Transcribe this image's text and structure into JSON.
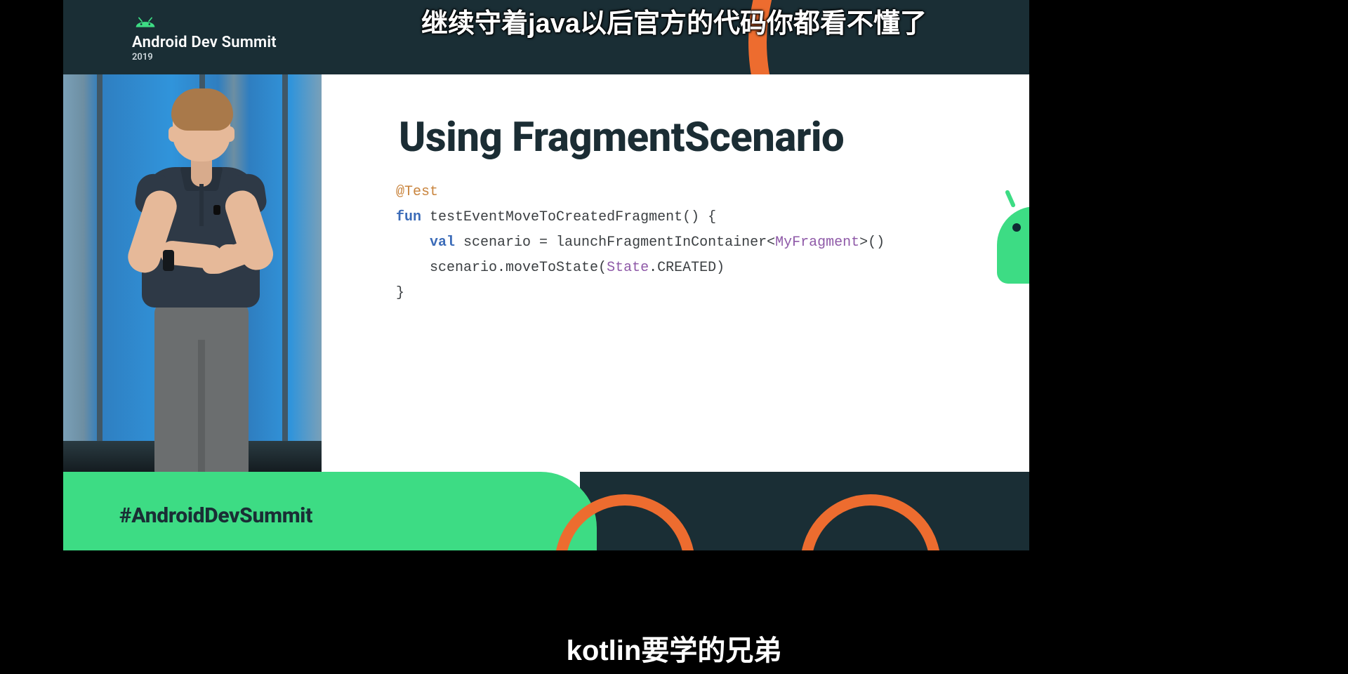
{
  "header": {
    "title": "Android Dev Summit",
    "year": "2019",
    "logo_name": "android-logo"
  },
  "slide": {
    "title": "Using FragmentScenario",
    "code": {
      "annotation": "@Test",
      "fun_kw": "fun",
      "fn_name": "testEventMoveToCreatedFragment",
      "fn_sig_suffix": "() {",
      "line2_indent": "    ",
      "val_kw": "val",
      "decl": " scenario = launchFragmentInContainer<",
      "type1": "MyFragment",
      "decl_tail": ">()",
      "line3_indent": "    ",
      "call_pre": "scenario.moveToState(",
      "type2": "State",
      "call_post": ".CREATED)",
      "brace_close": "}"
    }
  },
  "footer": {
    "hashtag": "#AndroidDevSummit"
  },
  "overlay": {
    "danmu_top": "继续守着java以后官方的代码你都看不懂了",
    "subtitle_bottom": "kotlin要学的兄弟"
  },
  "colors": {
    "brand_dark": "#1a2e35",
    "brand_green": "#3ddc84",
    "brand_orange": "#ed6c2f"
  }
}
